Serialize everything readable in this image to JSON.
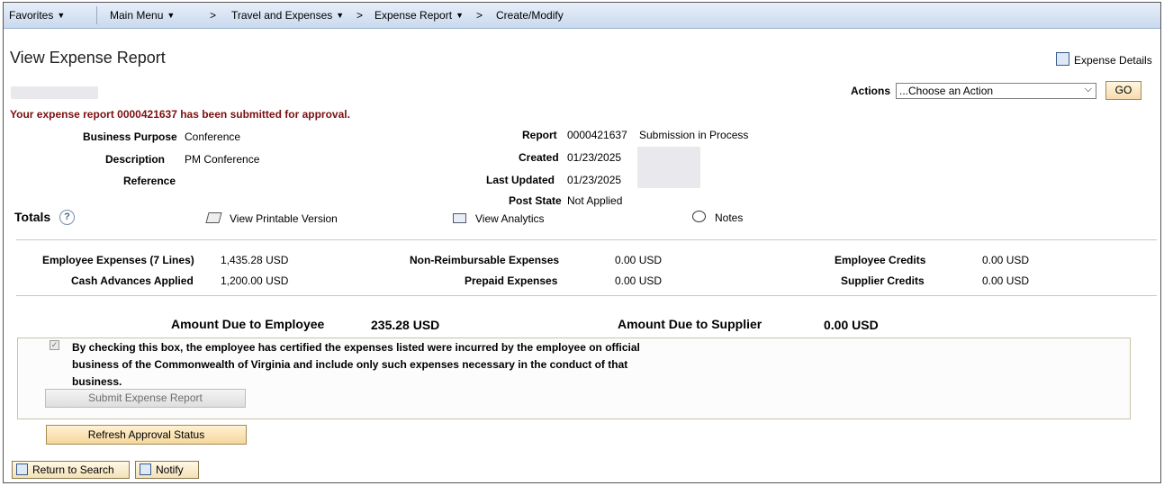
{
  "nav": {
    "favorites": "Favorites",
    "main_menu": "Main Menu",
    "crumb_sep": ">",
    "travel": "Travel and Expenses",
    "expense_report": "Expense Report",
    "create_modify": "Create/Modify"
  },
  "page": {
    "title": "View Expense Report",
    "expense_details": "Expense Details",
    "message": "Your expense report 0000421637 has been submitted for approval."
  },
  "actions": {
    "label": "Actions",
    "selected": "...Choose an Action",
    "go": "GO"
  },
  "header_fields": {
    "business_purpose_label": "Business Purpose",
    "business_purpose": "Conference",
    "description_label": "Description",
    "description": "PM Conference",
    "reference_label": "Reference",
    "report_label": "Report",
    "report_id": "0000421637",
    "report_status": "Submission in Process",
    "created_label": "Created",
    "created": "01/23/2025",
    "last_updated_label": "Last Updated",
    "last_updated": "01/23/2025",
    "post_state_label": "Post State",
    "post_state": "Not Applied"
  },
  "links": {
    "totals": "Totals",
    "help": "?",
    "printable": "View Printable Version",
    "analytics": "View Analytics",
    "notes": "Notes"
  },
  "totals": {
    "employee_expenses_label": "Employee Expenses (7 Lines)",
    "employee_expenses": "1,435.28",
    "cash_advances_label": "Cash Advances Applied",
    "cash_advances": "1,200.00",
    "non_reimbursable_label": "Non-Reimbursable Expenses",
    "non_reimbursable": "0.00",
    "prepaid_label": "Prepaid Expenses",
    "prepaid": "0.00",
    "employee_credits_label": "Employee Credits",
    "employee_credits": "0.00",
    "supplier_credits_label": "Supplier Credits",
    "supplier_credits": "0.00",
    "currency": "USD"
  },
  "due": {
    "employee_label": "Amount Due to Employee",
    "employee_amount": "235.28",
    "supplier_label": "Amount Due to Supplier",
    "supplier_amount": "0.00",
    "currency": "USD"
  },
  "certification": {
    "checked": true,
    "text": "By checking this box, the employee has certified the expenses listed were incurred by the employee on official business of the Commonwealth of Virginia and include only such expenses necessary in the conduct of that business.",
    "submit": "Submit Expense Report"
  },
  "buttons": {
    "refresh": "Refresh Approval Status",
    "return_to_search": "Return to Search",
    "notify": "Notify"
  }
}
